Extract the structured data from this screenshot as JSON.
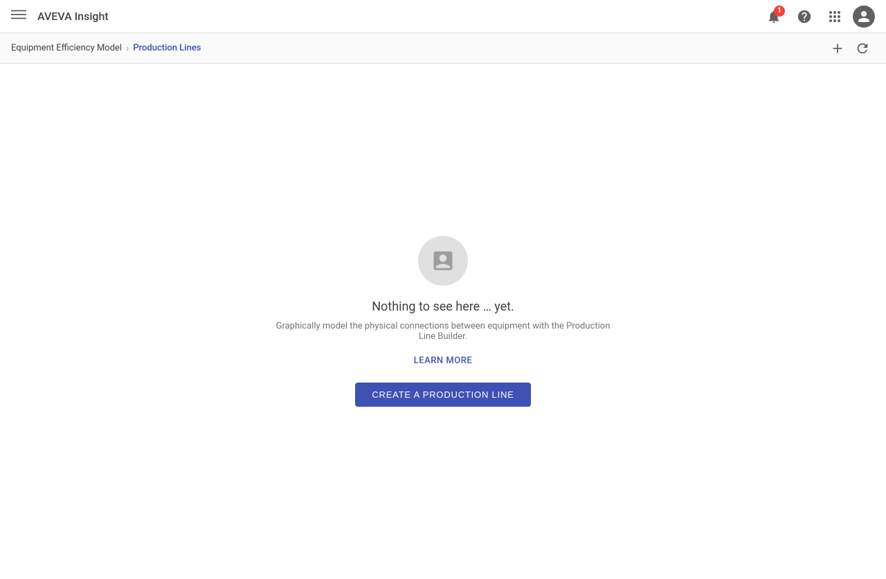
{
  "topbar": {
    "logo_text": "AVEVA Insight",
    "notification_count": "1",
    "menu_icon": "☰"
  },
  "breadcrumb": {
    "parent_label": "Equipment Efficiency Model",
    "separator": "›",
    "current_label": "Production Lines"
  },
  "empty_state": {
    "title": "Nothing to see here … yet.",
    "description": "Graphically model the physical connections between equipment with the Production Line Builder.",
    "learn_more_label": "LEARN MORE",
    "create_button_label": "CREATE A PRODUCTION LINE"
  }
}
